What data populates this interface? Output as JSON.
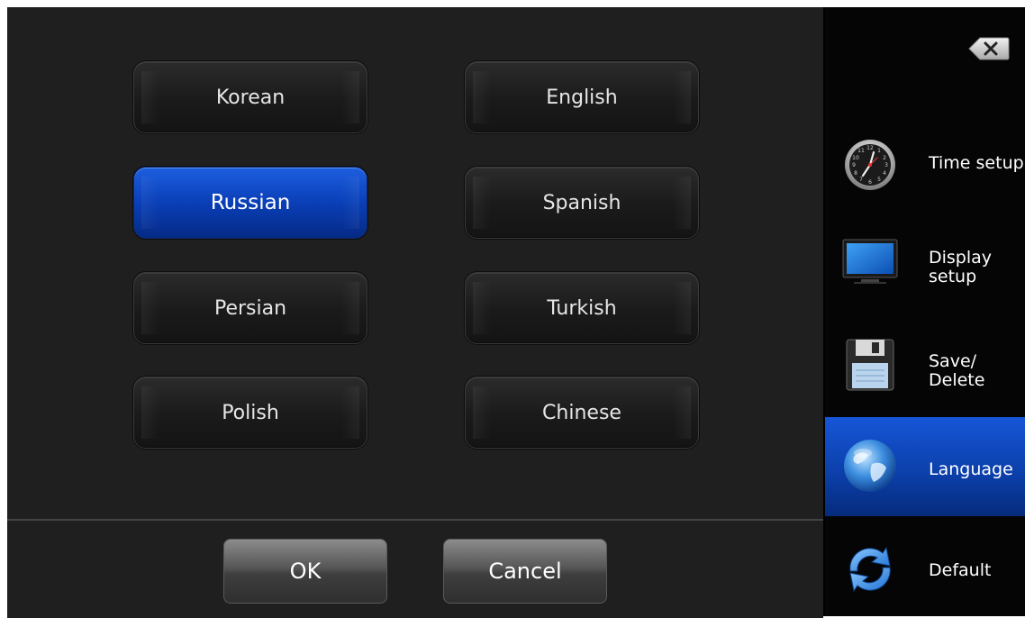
{
  "languages": {
    "korean": "Korean",
    "english": "English",
    "russian": "Russian",
    "spanish": "Spanish",
    "persian": "Persian",
    "turkish": "Turkish",
    "polish": "Polish",
    "chinese": "Chinese",
    "selected": "Russian"
  },
  "actions": {
    "ok_label": "OK",
    "cancel_label": "Cancel"
  },
  "sidebar": {
    "close_icon": "close-icon",
    "items": [
      {
        "label": "Time setup",
        "icon": "clock-icon"
      },
      {
        "label": "Display\nsetup",
        "icon": "monitor-icon"
      },
      {
        "label": "Save/\nDelete",
        "icon": "floppy-disk-icon"
      },
      {
        "label": "Language",
        "icon": "globe-icon",
        "active": true
      },
      {
        "label": "Default",
        "icon": "refresh-icon"
      }
    ]
  },
  "colors": {
    "selected_blue": "#0a3fb7",
    "panel_bg": "#1f1f1f",
    "sidebar_bg": "#050505"
  }
}
